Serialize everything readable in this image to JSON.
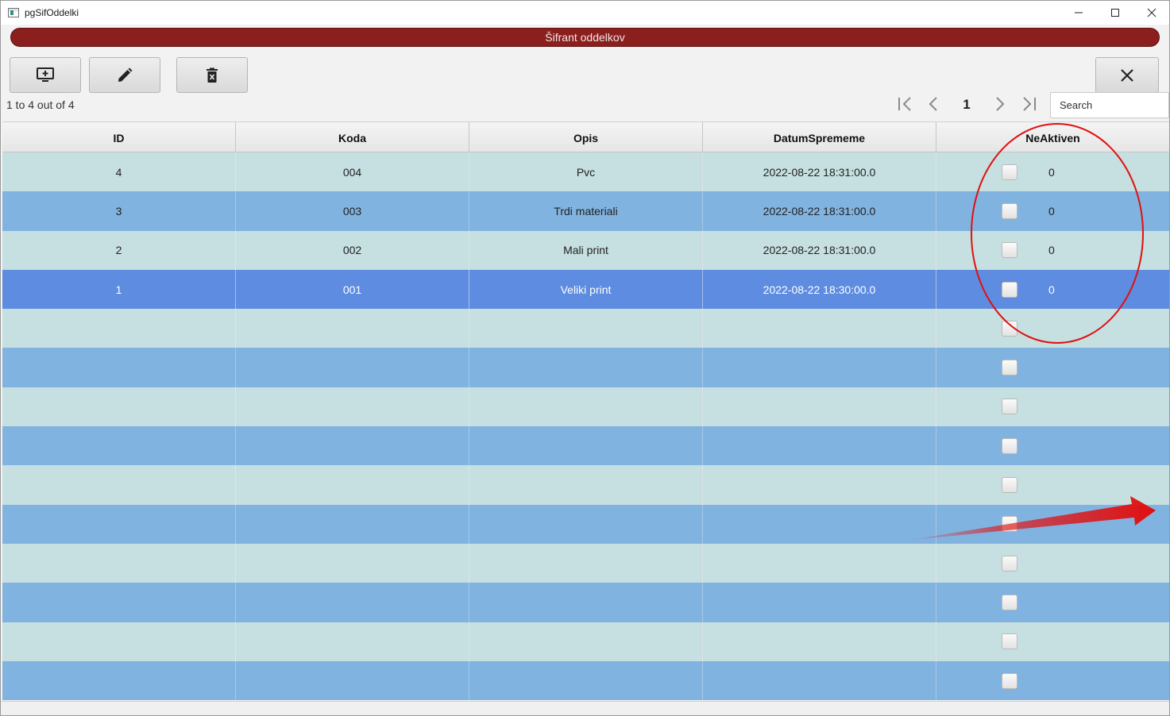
{
  "window": {
    "title": "pgSifOddelki",
    "minimize_icon": "minimize-icon",
    "maximize_icon": "maximize-icon",
    "close_icon": "close-icon"
  },
  "banner": {
    "title": "Šifrant oddelkov"
  },
  "toolbar": {
    "add_icon": "monitor-add-icon",
    "edit_icon": "pencil-icon",
    "delete_icon": "trash-icon",
    "close_icon": "close-icon"
  },
  "pager": {
    "info": "1 to 4 out of 4",
    "page": "1",
    "first_icon": "first-page-icon",
    "prev_icon": "prev-page-icon",
    "next_icon": "next-page-icon",
    "last_icon": "last-page-icon"
  },
  "search": {
    "placeholder": "Search",
    "value": ""
  },
  "table": {
    "columns": [
      "ID",
      "Koda",
      "Opis",
      "DatumSprememe",
      "NeAktiven"
    ],
    "rows": [
      {
        "id": "4",
        "koda": "004",
        "opis": "Pvc",
        "datum": "2022-08-22 18:31:00.0",
        "neaktiven": "0"
      },
      {
        "id": "3",
        "koda": "003",
        "opis": "Trdi materiali",
        "datum": "2022-08-22 18:31:00.0",
        "neaktiven": "0"
      },
      {
        "id": "2",
        "koda": "002",
        "opis": "Mali print",
        "datum": "2022-08-22 18:31:00.0",
        "neaktiven": "0"
      },
      {
        "id": "1",
        "koda": "001",
        "opis": "Veliki print",
        "datum": "2022-08-22 18:30:00.0",
        "neaktiven": "0"
      }
    ],
    "empty_rows": 10,
    "selected_row": 3
  },
  "annotations": {
    "ellipse_color": "#e01010",
    "arrow_color": "#e01010"
  }
}
